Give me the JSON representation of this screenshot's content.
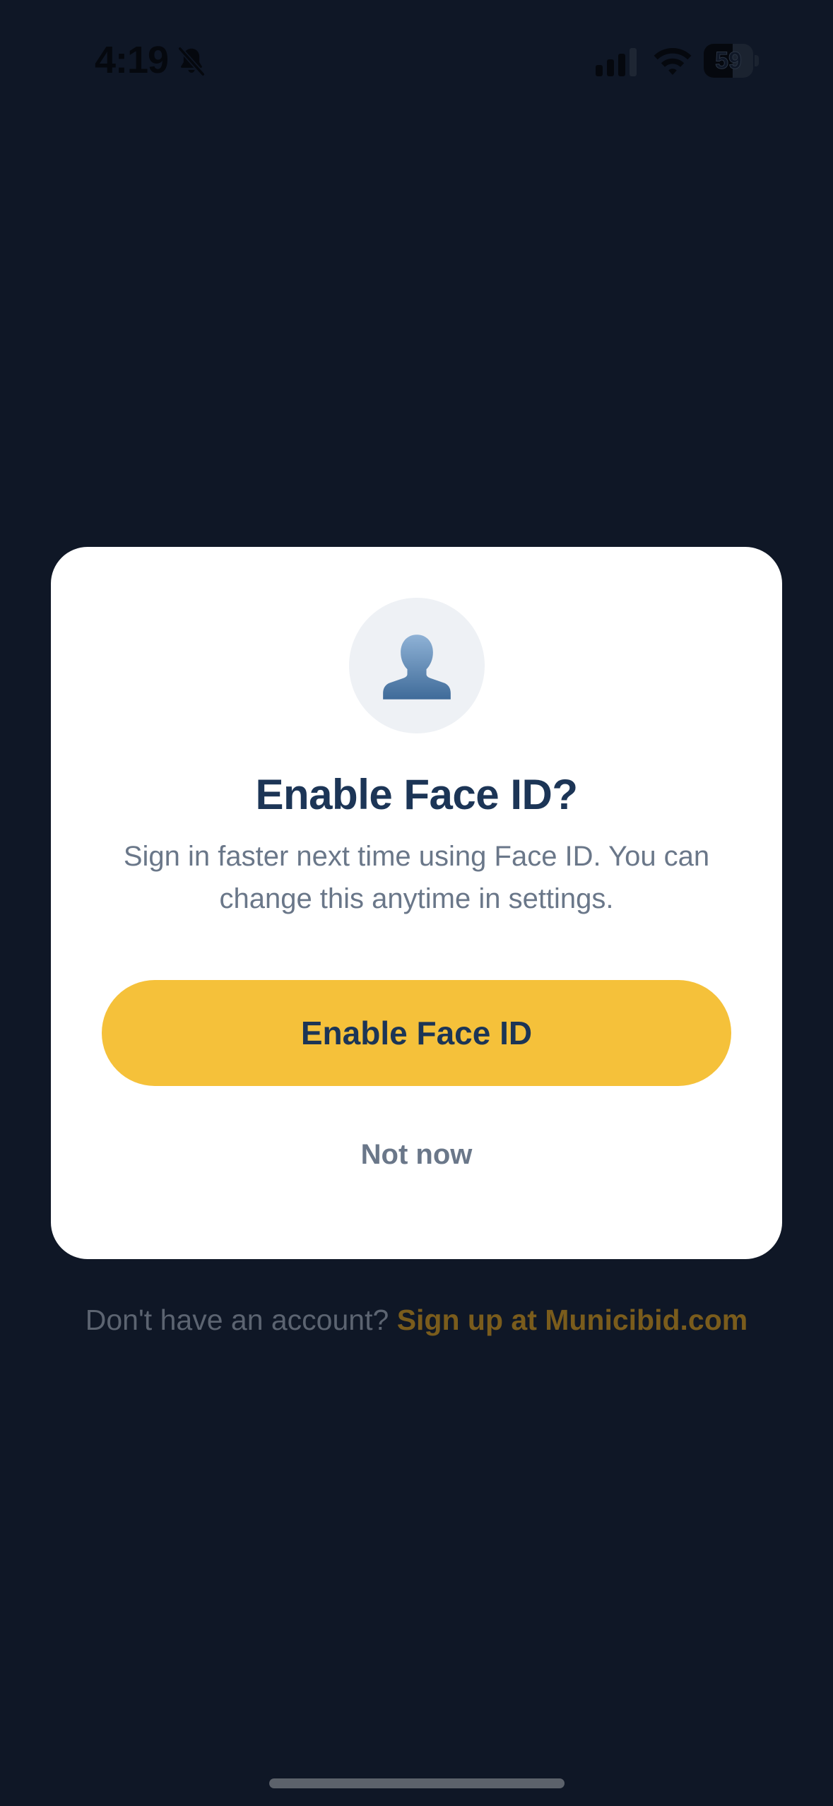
{
  "status_bar": {
    "time": "4:19",
    "battery_level": "59",
    "icons": [
      "bell-slash-icon",
      "cellular-signal-icon",
      "wifi-icon",
      "battery-icon"
    ]
  },
  "modal": {
    "avatar_icon": "person-silhouette-icon",
    "title": "Enable Face ID?",
    "body": "Sign in faster next time using Face ID. You can change this anytime in settings.",
    "primary_label": "Enable Face ID",
    "secondary_label": "Not now"
  },
  "footer": {
    "prompt": "Don't have an account?",
    "link": "Sign up at Municibid.com"
  },
  "colors": {
    "background": "#0f1726",
    "accent": "#f5c13a",
    "title": "#1c3556",
    "muted_text": "#6a7789",
    "link": "#7a5c1c"
  }
}
